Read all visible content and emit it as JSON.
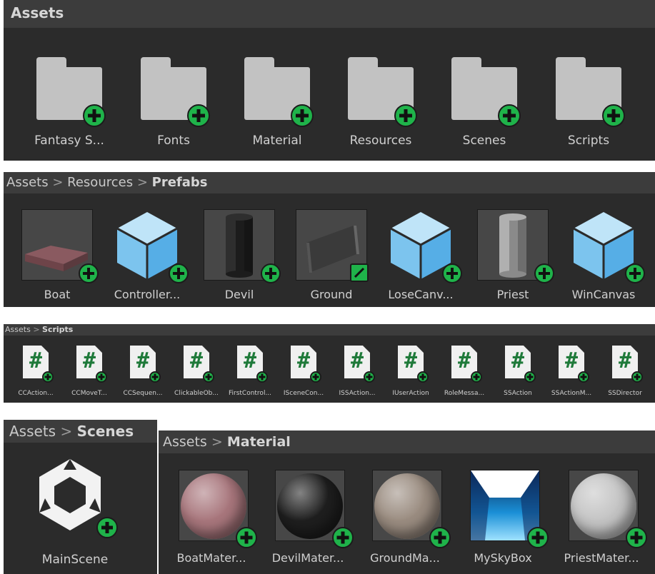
{
  "colors": {
    "panel": "#2b2b2b",
    "header": "#3c3c3c",
    "folder": "#c2c2c2",
    "plus": "#1fb34a",
    "cube": "#7cc4ee"
  },
  "assets_panel": {
    "title": "Assets",
    "items": [
      {
        "label": "Fantasy S...",
        "icon": "folder-icon"
      },
      {
        "label": "Fonts",
        "icon": "folder-icon"
      },
      {
        "label": "Material",
        "icon": "folder-icon"
      },
      {
        "label": "Resources",
        "icon": "folder-icon"
      },
      {
        "label": "Scenes",
        "icon": "folder-icon"
      },
      {
        "label": "Scripts",
        "icon": "folder-icon"
      }
    ]
  },
  "prefabs_panel": {
    "crumbs": [
      "Assets",
      "Resources",
      "Prefabs"
    ],
    "separator": ">",
    "items": [
      {
        "label": "Boat",
        "icon": "boat-prefab-icon"
      },
      {
        "label": "Controller...",
        "icon": "cube-prefab-icon"
      },
      {
        "label": "Devil",
        "icon": "cylinder-prefab-icon"
      },
      {
        "label": "Ground",
        "icon": "plane-prefab-icon"
      },
      {
        "label": "LoseCanv...",
        "icon": "cube-prefab-icon"
      },
      {
        "label": "Priest",
        "icon": "cylinder-prefab-icon"
      },
      {
        "label": "WinCanvas",
        "icon": "cube-prefab-icon"
      }
    ]
  },
  "scripts_panel": {
    "crumbs": [
      "Assets",
      "Scripts"
    ],
    "separator": ">",
    "glyph": "#",
    "items": [
      {
        "label": "CCAction..."
      },
      {
        "label": "CCMoveT..."
      },
      {
        "label": "CCSequen..."
      },
      {
        "label": "ClickableOb..."
      },
      {
        "label": "FirstControl..."
      },
      {
        "label": "ISceneCon..."
      },
      {
        "label": "ISSAction..."
      },
      {
        "label": "IUserAction"
      },
      {
        "label": "RoleMessa..."
      },
      {
        "label": "SSAction"
      },
      {
        "label": "SSActionM..."
      },
      {
        "label": "SSDirector"
      }
    ]
  },
  "scenes_panel": {
    "crumbs": [
      "Assets",
      "Scenes"
    ],
    "separator": ">",
    "items": [
      {
        "label": "MainScene",
        "icon": "unity-scene-icon"
      }
    ]
  },
  "material_panel": {
    "crumbs": [
      "Assets",
      "Material"
    ],
    "separator": ">",
    "items": [
      {
        "label": "BoatMater...",
        "icon": "material-sphere-icon",
        "color": "#a8767c"
      },
      {
        "label": "DevilMater...",
        "icon": "material-sphere-icon",
        "color": "#1e1e1e"
      },
      {
        "label": "GroundMa...",
        "icon": "material-sphere-icon",
        "color": "#9a8c80"
      },
      {
        "label": "MySkyBox",
        "icon": "skybox-icon",
        "color": "#1a8fd6"
      },
      {
        "label": "PriestMater...",
        "icon": "material-sphere-icon",
        "color": "#c4c4c4"
      }
    ]
  }
}
